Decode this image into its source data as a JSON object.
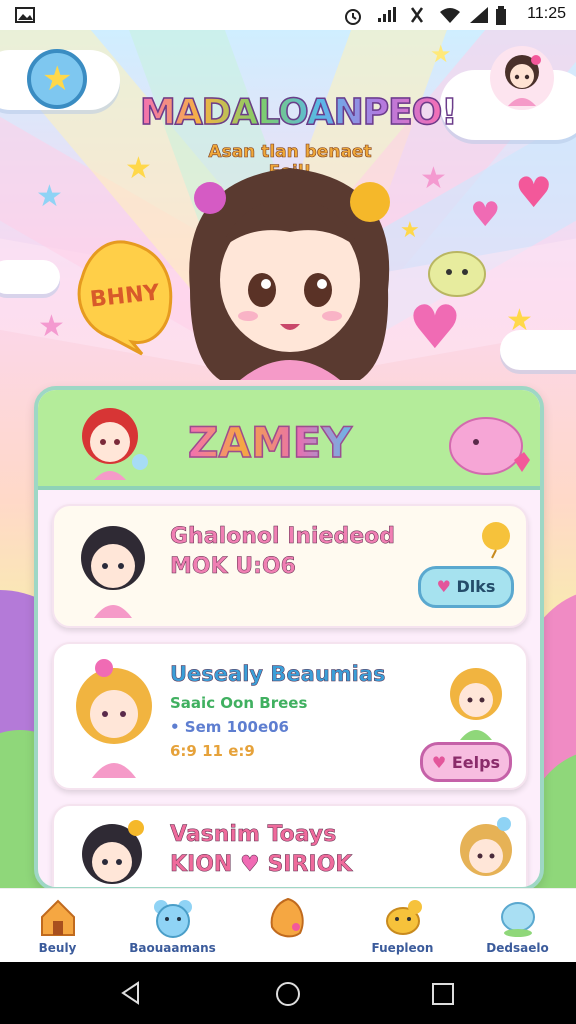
{
  "status_bar": {
    "time": "11:25"
  },
  "header": {
    "title": "MADALOANPEO!",
    "subtitle": "Asan tlan benaet Eoil!",
    "star_button_icon": "star-icon",
    "avatar_icon": "avatar-girl-icon"
  },
  "speech_bubble": {
    "text": "BHNY"
  },
  "panel": {
    "title": "ZAMEY",
    "cards": [
      {
        "name": "Ghalonol Iniedeod",
        "line1": "MOK U:O6",
        "button_label": "Dlks"
      },
      {
        "name": "Uesealy Beaumias",
        "line1": "Saaic Oon Brees",
        "line2": "• Sem 100e06",
        "line3": "6:9 11 e:9",
        "button_label": "Eelps"
      },
      {
        "name": "Vasnim Toays",
        "line1": "KION",
        "line2": "SIRIOK"
      }
    ]
  },
  "bottom_nav": [
    {
      "label": "Beuly",
      "icon": "house-icon"
    },
    {
      "label": "Baouaamans",
      "icon": "bear-face-icon"
    },
    {
      "label": "",
      "icon": "cheese-icon"
    },
    {
      "label": "Fuepleon",
      "icon": "puppy-icon"
    },
    {
      "label": "Dedsaelo",
      "icon": "blob-icon"
    }
  ],
  "colors": {
    "accent_pink": "#f36fb6",
    "accent_blue": "#58b8e8",
    "panel_border": "#9ed7c5"
  }
}
